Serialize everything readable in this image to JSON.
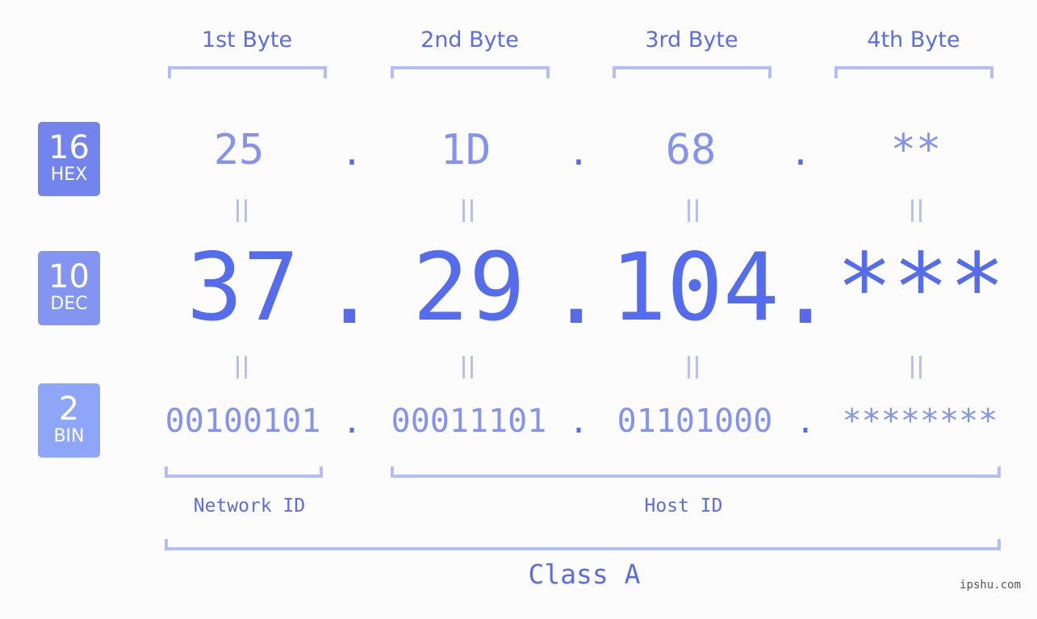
{
  "bases": [
    {
      "number": "16",
      "label": "HEX"
    },
    {
      "number": "10",
      "label": "DEC"
    },
    {
      "number": "2",
      "label": "BIN"
    }
  ],
  "byte_headers": [
    "1st Byte",
    "2nd Byte",
    "3rd Byte",
    "4th Byte"
  ],
  "hex": [
    "25",
    "1D",
    "68",
    "**"
  ],
  "dec": [
    "37",
    "29",
    "104",
    "***"
  ],
  "bin": [
    "00100101",
    "00011101",
    "01101000",
    "********"
  ],
  "separator": ".",
  "network_id_label": "Network ID",
  "host_id_label": "Host ID",
  "class_label": "Class A",
  "watermark": "ipshu.com",
  "colors": {
    "accent": "#556ced",
    "hex_badge": "#7384ec",
    "dec_badge": "#8394f1",
    "bin_badge": "#8ea6f8",
    "bracket": "#b3bdf6"
  }
}
